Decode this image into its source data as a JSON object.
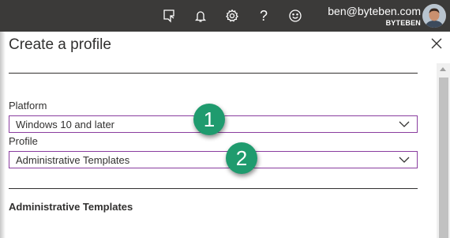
{
  "topbar": {
    "icons": [
      "feedback-icon",
      "notification-icon",
      "settings-icon",
      "help-icon",
      "smiley-icon"
    ],
    "help_glyph": "?",
    "user": {
      "email": "ben@byteben.com",
      "tenant": "BYTEBEN"
    }
  },
  "panel": {
    "title": "Create a profile",
    "close_icon": "close-icon"
  },
  "form": {
    "platform": {
      "label": "Platform",
      "value": "Windows 10 and later"
    },
    "profile": {
      "label": "Profile",
      "value": "Administrative Templates"
    }
  },
  "section": {
    "heading": "Administrative Templates"
  },
  "callouts": [
    "1",
    "2"
  ],
  "colors": {
    "topbar": "#3b3a39",
    "dropdown_border": "#8a3d9f",
    "callout": "#1f9b6e"
  }
}
